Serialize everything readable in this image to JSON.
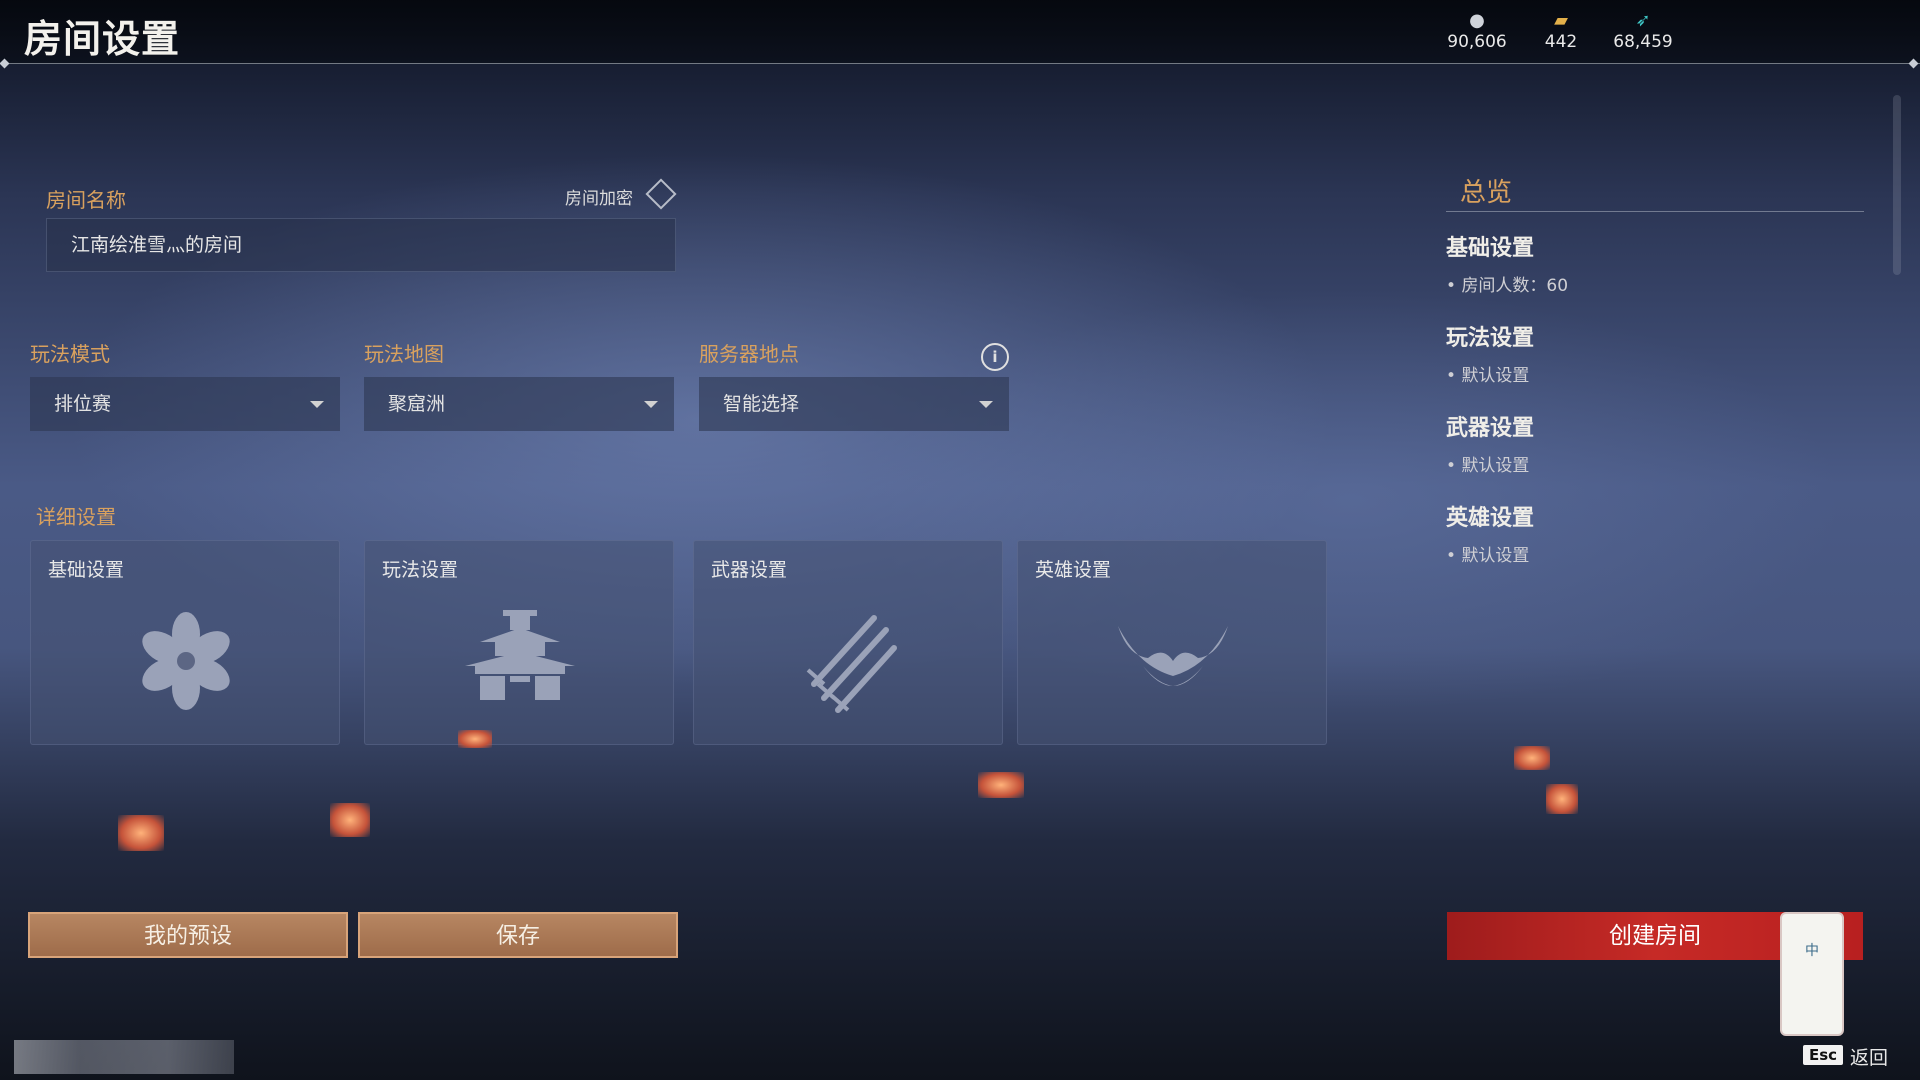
{
  "header": {
    "title": "房间设置",
    "currencies": [
      {
        "icon": "coin-icon",
        "value": "90,606"
      },
      {
        "icon": "ticket-icon",
        "value": "442"
      },
      {
        "icon": "feather-icon",
        "value": "68,459"
      }
    ]
  },
  "room": {
    "name_label": "房间名称",
    "name_value": "江南绘淮雪灬的房间",
    "encrypt_label": "房间加密"
  },
  "selectors": {
    "mode": {
      "label": "玩法模式",
      "value": "排位赛"
    },
    "map": {
      "label": "玩法地图",
      "value": "聚窟洲"
    },
    "server": {
      "label": "服务器地点",
      "value": "智能选择"
    }
  },
  "detail": {
    "label": "详细设置",
    "cards": [
      {
        "title": "基础设置",
        "icon": "flower-icon"
      },
      {
        "title": "玩法设置",
        "icon": "pagoda-icon"
      },
      {
        "title": "武器设置",
        "icon": "swords-icon"
      },
      {
        "title": "英雄设置",
        "icon": "mask-icon"
      }
    ]
  },
  "overview": {
    "title": "总览",
    "sections": [
      {
        "heading": "基础设置",
        "detail": "房间人数：60"
      },
      {
        "heading": "玩法设置",
        "detail": "默认设置"
      },
      {
        "heading": "武器设置",
        "detail": "默认设置"
      },
      {
        "heading": "英雄设置",
        "detail": "默认设置"
      }
    ]
  },
  "buttons": {
    "presets": "我的预设",
    "save": "保存",
    "create": "创建房间",
    "esc_key": "Esc",
    "back": "返回"
  },
  "mascot_text": "中"
}
